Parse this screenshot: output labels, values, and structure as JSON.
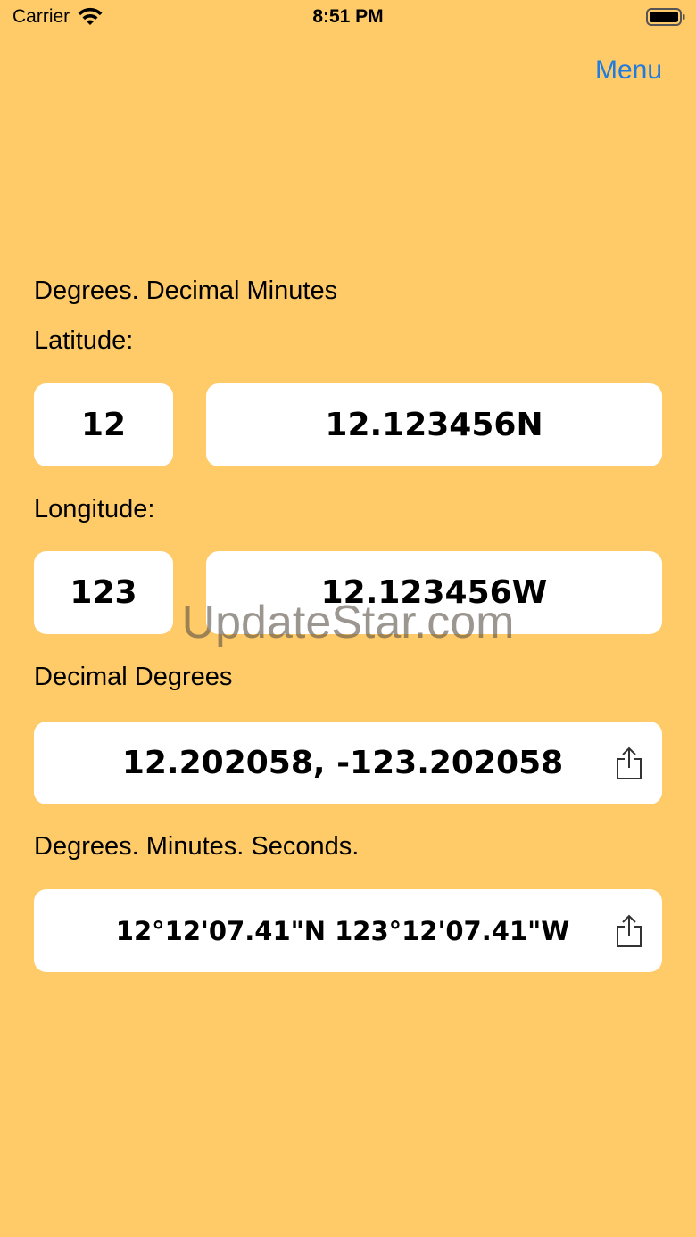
{
  "status_bar": {
    "carrier": "Carrier",
    "time": "8:51 PM",
    "wifi_icon": "wifi-icon",
    "battery_icon": "battery-icon"
  },
  "nav": {
    "menu_label": "Menu"
  },
  "ddm": {
    "section_title": "Degrees. Decimal Minutes",
    "latitude_label": "Latitude:",
    "latitude_degrees": "12",
    "latitude_minutes": "12.123456N",
    "longitude_label": "Longitude:",
    "longitude_degrees": "123",
    "longitude_minutes": "12.123456W"
  },
  "dd": {
    "section_title": "Decimal Degrees",
    "value": "12.202058, -123.202058",
    "share_icon": "share-icon"
  },
  "dms": {
    "section_title": "Degrees. Minutes. Seconds.",
    "value": "12°12'07.41\"N 123°12'07.41\"W",
    "share_icon": "share-icon"
  },
  "watermark": "UpdateStar.com",
  "colors": {
    "background": "#FFCA68",
    "accent": "#1E7BE0",
    "field": "#FFFFFF"
  }
}
